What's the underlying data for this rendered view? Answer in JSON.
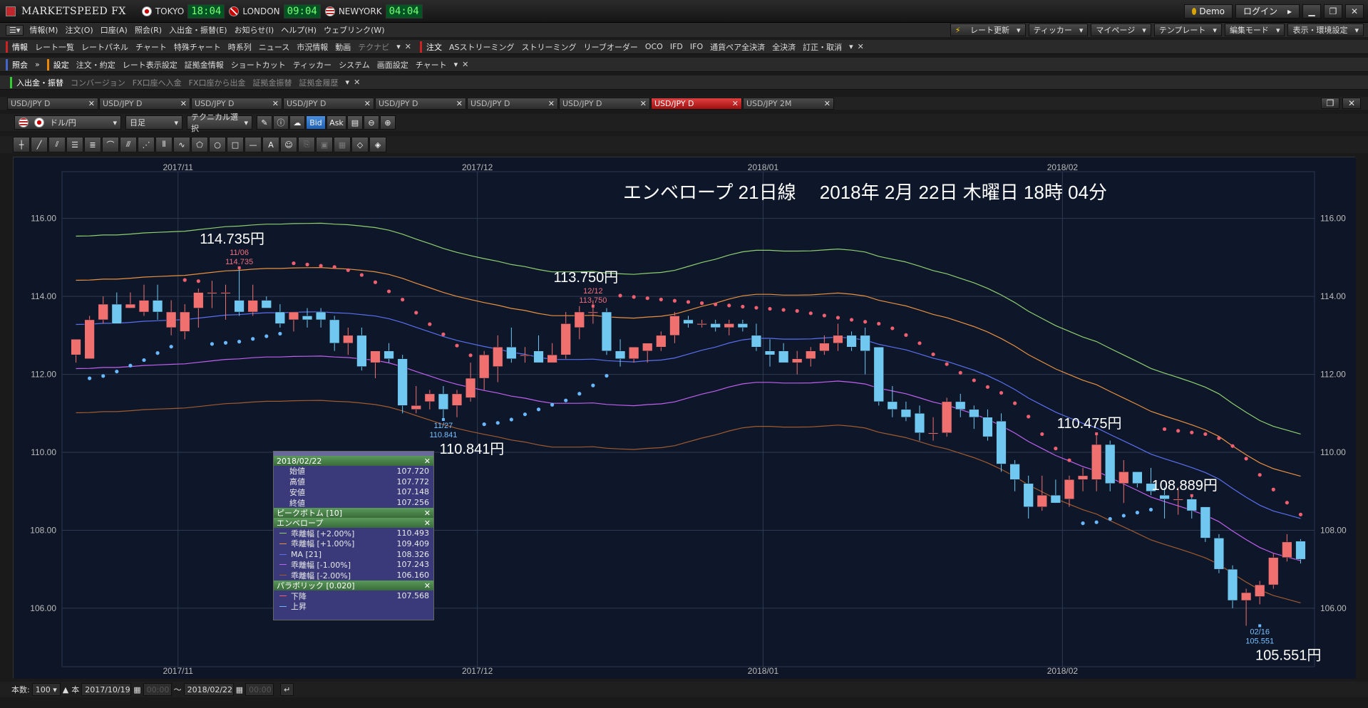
{
  "titlebar": {
    "app_name": "MARKETSPEED FX",
    "clocks": [
      {
        "city": "TOKYO",
        "time": "18:04"
      },
      {
        "city": "LONDON",
        "time": "09:04"
      },
      {
        "city": "NEWYORK",
        "time": "04:04"
      }
    ],
    "demo_label": "Demo",
    "login_label": "ログイン"
  },
  "menu": {
    "items": [
      "情報(M)",
      "注文(O)",
      "口座(A)",
      "照会(R)",
      "入出金・振替(E)",
      "お知らせ(I)",
      "ヘルプ(H)",
      "ウェブリンク(W)"
    ],
    "right": [
      "レート更新",
      "ティッカー",
      "マイページ",
      "テンプレート",
      "編集モード",
      "表示・環境設定"
    ]
  },
  "toolbar1": {
    "section_info": "情報",
    "info_items": [
      "レート一覧",
      "レートパネル",
      "チャート",
      "特殊チャート",
      "時系列",
      "ニュース",
      "市況情報",
      "動画",
      "テクナビ"
    ],
    "section_order": "注文",
    "order_items": [
      "ASストリーミング",
      "ストリーミング",
      "リーブオーダー",
      "OCO",
      "IFD",
      "IFO",
      "通貨ペア全決済",
      "全決済",
      "訂正・取消"
    ]
  },
  "toolbar2": {
    "section_inquiry": "照会",
    "section_settings": "設定",
    "settings_items": [
      "注文・約定",
      "レート表示設定",
      "証拠金情報",
      "ショートカット",
      "ティッカー",
      "システム",
      "画面設定",
      "チャート"
    ]
  },
  "toolbar3": {
    "section_deposit": "入出金・振替",
    "deposit_items": [
      "コンバージョン",
      "FX口座へ入金",
      "FX口座から出金",
      "証拠金振替",
      "証拠金履歴"
    ]
  },
  "tabs": [
    {
      "label": "USD/JPY D",
      "active": false
    },
    {
      "label": "USD/JPY D",
      "active": false
    },
    {
      "label": "USD/JPY D",
      "active": false
    },
    {
      "label": "USD/JPY D",
      "active": false
    },
    {
      "label": "USD/JPY D",
      "active": false
    },
    {
      "label": "USD/JPY D",
      "active": false
    },
    {
      "label": "USD/JPY D",
      "active": false
    },
    {
      "label": "USD/JPY D",
      "active": true
    },
    {
      "label": "USD/JPY 2M",
      "active": false
    }
  ],
  "controls": {
    "pair": "ドル/円",
    "period": "日足",
    "technical": "テクニカル選択",
    "bid": "Bid",
    "ask": "Ask"
  },
  "status": {
    "count_label": "本数:",
    "count_value": "100",
    "count_unit": "本",
    "from_date": "2017/10/19",
    "from_time": "00:00",
    "tilde": "〜",
    "to_date": "2018/02/22",
    "to_time": "00:00"
  },
  "popup": {
    "date": "2018/02/22",
    "ohlc": [
      {
        "label": "始値",
        "value": "107.720"
      },
      {
        "label": "高値",
        "value": "107.772"
      },
      {
        "label": "安値",
        "value": "107.148"
      },
      {
        "label": "終値",
        "value": "107.256"
      }
    ],
    "peak_bottom": "ピークボトム [10]",
    "envelope": "エンベロープ",
    "env_lines": [
      {
        "label": "乖離幅 [+2.00%]",
        "value": "110.493",
        "color": "#8fcf6f"
      },
      {
        "label": "乖離幅 [+1.00%]",
        "value": "109.409",
        "color": "#e89040"
      },
      {
        "label": "MA [21]",
        "value": "108.326",
        "color": "#5a6ff0"
      },
      {
        "label": "乖離幅 [-1.00%]",
        "value": "107.243",
        "color": "#c060f0"
      },
      {
        "label": "乖離幅 [-2.00%]",
        "value": "106.160",
        "color": "#a05a30"
      }
    ],
    "parabolic": "パラボリック [0.020]",
    "para_lines": [
      {
        "label": "下降",
        "value": "107.568",
        "color": "#f06070"
      },
      {
        "label": "上昇",
        "value": "",
        "color": "#6ab8ff"
      }
    ]
  },
  "chart_data": {
    "type": "candlestick",
    "title": "エンベロープ 21日線　 2018年 2月 22日 木曜日 18時 04分",
    "month_labels": [
      {
        "label": "2017/11",
        "index": 8
      },
      {
        "label": "2017/12",
        "index": 30
      },
      {
        "label": "2018/01",
        "index": 51
      },
      {
        "label": "2018/02",
        "index": 73
      }
    ],
    "ylim": [
      104.5,
      117.2
    ],
    "yticks": [
      "116.00",
      "114.00",
      "112.00",
      "110.00",
      "108.00",
      "106.00"
    ],
    "annotations": [
      {
        "text": "114.735円",
        "small_date": "11/06",
        "small_value": "114.735",
        "index": 12,
        "price": 114.735,
        "type": "high"
      },
      {
        "text": "110.841円",
        "small_date": "11/27",
        "small_value": "110.841",
        "index": 27,
        "price": 110.841,
        "type": "low"
      },
      {
        "text": "113.750円",
        "small_date": "12/12",
        "small_value": "113.750",
        "index": 38,
        "price": 113.75,
        "type": "high"
      },
      {
        "text": "110.475円",
        "small_date": "",
        "small_value": "",
        "index": 75,
        "price": 110.475,
        "type": "high"
      },
      {
        "text": "108.889円",
        "small_date": "",
        "small_value": "",
        "index": 82,
        "price": 108.889,
        "type": "high"
      },
      {
        "text": "105.551円",
        "small_date": "02/16",
        "small_value": "105.551",
        "index": 87,
        "price": 105.551,
        "type": "low"
      }
    ],
    "candles": [
      [
        112.5,
        112.9,
        112.3,
        112.9
      ],
      [
        112.4,
        113.5,
        112.4,
        113.4
      ],
      [
        113.4,
        114.0,
        113.3,
        113.8
      ],
      [
        113.8,
        114.1,
        113.3,
        113.3
      ],
      [
        113.7,
        114.1,
        113.7,
        113.8
      ],
      [
        113.6,
        114.3,
        113.5,
        113.9
      ],
      [
        113.9,
        114.3,
        113.4,
        113.6
      ],
      [
        113.2,
        113.9,
        113.0,
        113.6
      ],
      [
        113.1,
        113.8,
        112.9,
        113.6
      ],
      [
        113.7,
        114.2,
        113.2,
        114.1
      ],
      [
        114.1,
        114.4,
        113.7,
        114.1
      ],
      [
        114.1,
        114.3,
        113.4,
        114.1
      ],
      [
        113.9,
        114.73,
        113.5,
        113.6
      ],
      [
        113.6,
        114.3,
        113.5,
        113.9
      ],
      [
        113.9,
        114.0,
        113.7,
        113.7
      ],
      [
        113.6,
        113.8,
        113.2,
        113.3
      ],
      [
        113.4,
        113.6,
        113.1,
        113.6
      ],
      [
        113.5,
        113.7,
        113.2,
        113.4
      ],
      [
        113.6,
        113.7,
        113.2,
        113.4
      ],
      [
        113.4,
        113.5,
        112.6,
        112.8
      ],
      [
        112.8,
        113.2,
        112.5,
        113.0
      ],
      [
        113.0,
        113.2,
        112.1,
        112.2
      ],
      [
        112.3,
        112.6,
        111.9,
        112.6
      ],
      [
        112.6,
        112.8,
        112.3,
        112.4
      ],
      [
        112.4,
        112.5,
        111.0,
        111.2
      ],
      [
        111.1,
        111.7,
        111.0,
        111.2
      ],
      [
        111.3,
        111.6,
        111.1,
        111.5
      ],
      [
        111.5,
        111.7,
        110.84,
        111.1
      ],
      [
        111.2,
        111.6,
        110.9,
        111.5
      ],
      [
        111.4,
        112.3,
        111.3,
        111.9
      ],
      [
        111.9,
        112.6,
        111.6,
        112.5
      ],
      [
        112.2,
        113.0,
        111.8,
        112.7
      ],
      [
        112.7,
        113.2,
        112.3,
        112.4
      ],
      [
        112.5,
        112.7,
        112.3,
        112.5
      ],
      [
        112.6,
        113.0,
        112.4,
        112.3
      ],
      [
        112.3,
        112.8,
        112.3,
        112.5
      ],
      [
        112.5,
        113.6,
        112.4,
        113.3
      ],
      [
        113.2,
        113.75,
        112.9,
        113.6
      ],
      [
        113.6,
        113.9,
        113.3,
        113.6
      ],
      [
        113.6,
        113.7,
        112.5,
        112.6
      ],
      [
        112.6,
        112.9,
        112.2,
        112.4
      ],
      [
        112.4,
        112.7,
        112.3,
        112.7
      ],
      [
        112.6,
        112.8,
        112.3,
        112.8
      ],
      [
        112.7,
        113.1,
        112.6,
        113.0
      ],
      [
        113.0,
        113.6,
        112.8,
        113.5
      ],
      [
        113.4,
        113.5,
        113.2,
        113.3
      ],
      [
        113.3,
        113.4,
        113.2,
        113.3
      ],
      [
        113.3,
        113.4,
        113.1,
        113.2
      ],
      [
        113.2,
        113.4,
        113.0,
        113.3
      ],
      [
        113.3,
        113.4,
        113.1,
        113.2
      ],
      [
        113.0,
        113.3,
        112.6,
        112.7
      ],
      [
        112.6,
        112.9,
        112.2,
        112.5
      ],
      [
        112.6,
        112.8,
        112.3,
        112.3
      ],
      [
        112.3,
        112.6,
        112.0,
        112.4
      ],
      [
        112.4,
        112.7,
        112.2,
        112.6
      ],
      [
        112.6,
        113.0,
        112.5,
        112.8
      ],
      [
        112.8,
        113.3,
        112.6,
        113.0
      ],
      [
        113.0,
        113.1,
        112.6,
        112.7
      ],
      [
        113.0,
        113.2,
        112.0,
        112.6
      ],
      [
        112.7,
        112.7,
        111.2,
        111.3
      ],
      [
        111.3,
        111.7,
        110.9,
        111.1
      ],
      [
        111.1,
        111.3,
        110.8,
        110.9
      ],
      [
        111.0,
        111.2,
        110.3,
        110.5
      ],
      [
        110.5,
        110.9,
        110.3,
        110.5
      ],
      [
        110.5,
        111.4,
        110.4,
        111.3
      ],
      [
        111.3,
        111.5,
        110.9,
        111.1
      ],
      [
        111.1,
        111.2,
        110.6,
        110.9
      ],
      [
        110.9,
        111.1,
        110.3,
        110.4
      ],
      [
        110.8,
        111.0,
        109.5,
        109.7
      ],
      [
        109.7,
        109.8,
        109.0,
        109.3
      ],
      [
        109.2,
        109.4,
        108.3,
        108.6
      ],
      [
        108.6,
        109.4,
        108.5,
        108.9
      ],
      [
        108.9,
        109.3,
        108.7,
        108.7
      ],
      [
        108.8,
        109.4,
        108.6,
        109.3
      ],
      [
        109.3,
        109.6,
        109.0,
        109.4
      ],
      [
        109.3,
        110.475,
        109.0,
        110.2
      ],
      [
        110.2,
        110.3,
        109.0,
        109.2
      ],
      [
        109.2,
        109.8,
        108.7,
        109.5
      ],
      [
        109.5,
        109.5,
        109.1,
        109.2
      ],
      [
        109.2,
        109.6,
        108.9,
        109.0
      ],
      [
        108.9,
        109.1,
        108.3,
        108.8
      ],
      [
        108.8,
        109.1,
        108.4,
        108.8
      ],
      [
        108.8,
        108.889,
        108.3,
        108.5
      ],
      [
        108.6,
        108.6,
        107.7,
        107.8
      ],
      [
        107.8,
        107.9,
        106.9,
        107.0
      ],
      [
        107.0,
        107.1,
        106.0,
        106.2
      ],
      [
        106.2,
        106.5,
        105.55,
        106.4
      ],
      [
        106.3,
        106.7,
        106.1,
        106.6
      ],
      [
        106.6,
        107.4,
        106.5,
        107.3
      ],
      [
        107.3,
        107.9,
        107.2,
        107.7
      ],
      [
        107.72,
        107.772,
        107.148,
        107.256
      ]
    ]
  },
  "colors": {
    "up": "#f07070",
    "down": "#70c8f0",
    "env_p2": "#8fcf6f",
    "env_p1": "#e89040",
    "ma": "#5a6ff0",
    "env_m1": "#c060f0",
    "env_m2": "#a05a30",
    "sar_down": "#f06070",
    "sar_up": "#6ab8ff",
    "accent_tab": "#c02020"
  }
}
